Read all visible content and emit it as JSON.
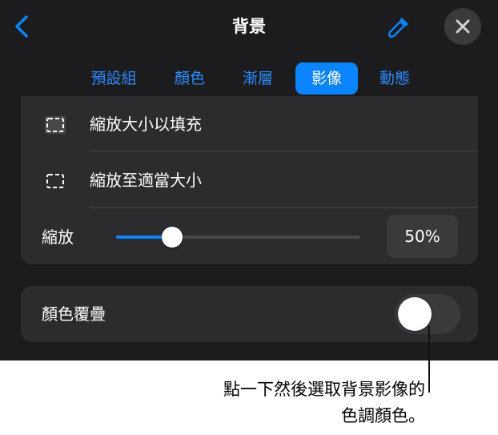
{
  "header": {
    "title": "背景",
    "back_icon": "chevron-left-icon",
    "dropper_icon": "eyedropper-icon",
    "close_icon": "close-icon"
  },
  "tabs": [
    {
      "label": "預設組",
      "active": false
    },
    {
      "label": "顏色",
      "active": false
    },
    {
      "label": "漸層",
      "active": false
    },
    {
      "label": "影像",
      "active": true
    },
    {
      "label": "動態",
      "active": false
    }
  ],
  "image_options": {
    "fill_label": "縮放大小以填充",
    "fit_label": "縮放至適當大小",
    "zoom_label": "縮放",
    "zoom_value": "50%",
    "zoom_fraction": 0.23
  },
  "overlay": {
    "label": "顏色覆疊",
    "enabled": false
  },
  "callout": {
    "line1": "點一下然後選取背景影像的",
    "line2": "色調顏色。"
  },
  "colors": {
    "accent": "#0a84ff",
    "panel_bg": "#1c1c1e",
    "card_bg": "#2c2c2e"
  }
}
